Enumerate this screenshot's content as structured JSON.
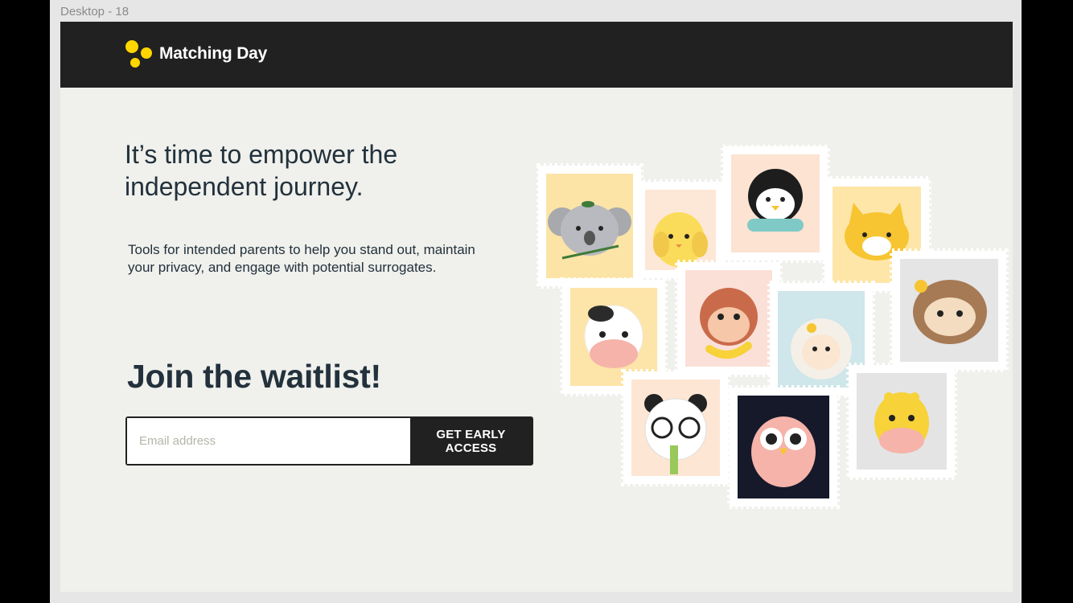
{
  "frame": {
    "label": "Desktop - 18"
  },
  "header": {
    "brand": "Matching Day",
    "logo_icon": "three-dots-logo-icon"
  },
  "hero": {
    "headline_line1": "It’s time to empower the",
    "headline_line2": "independent journey.",
    "subcopy": "Tools for intended parents to help you stand out, maintain your privacy, and engage with potential surrogates."
  },
  "waitlist": {
    "heading": "Join the waitlist!",
    "email_placeholder": "Email address",
    "email_value": "",
    "button_label": "GET EARLY ACCESS"
  },
  "illustration": {
    "stamps": [
      "koala",
      "chick",
      "penguin",
      "cat",
      "cow",
      "monkey",
      "sheep",
      "sloth",
      "panda",
      "owl",
      "giraffe"
    ]
  },
  "colors": {
    "header_bg": "#212121",
    "page_bg": "#f0f0ec",
    "text": "#22313c",
    "accent_yellow": "#ffd600"
  }
}
